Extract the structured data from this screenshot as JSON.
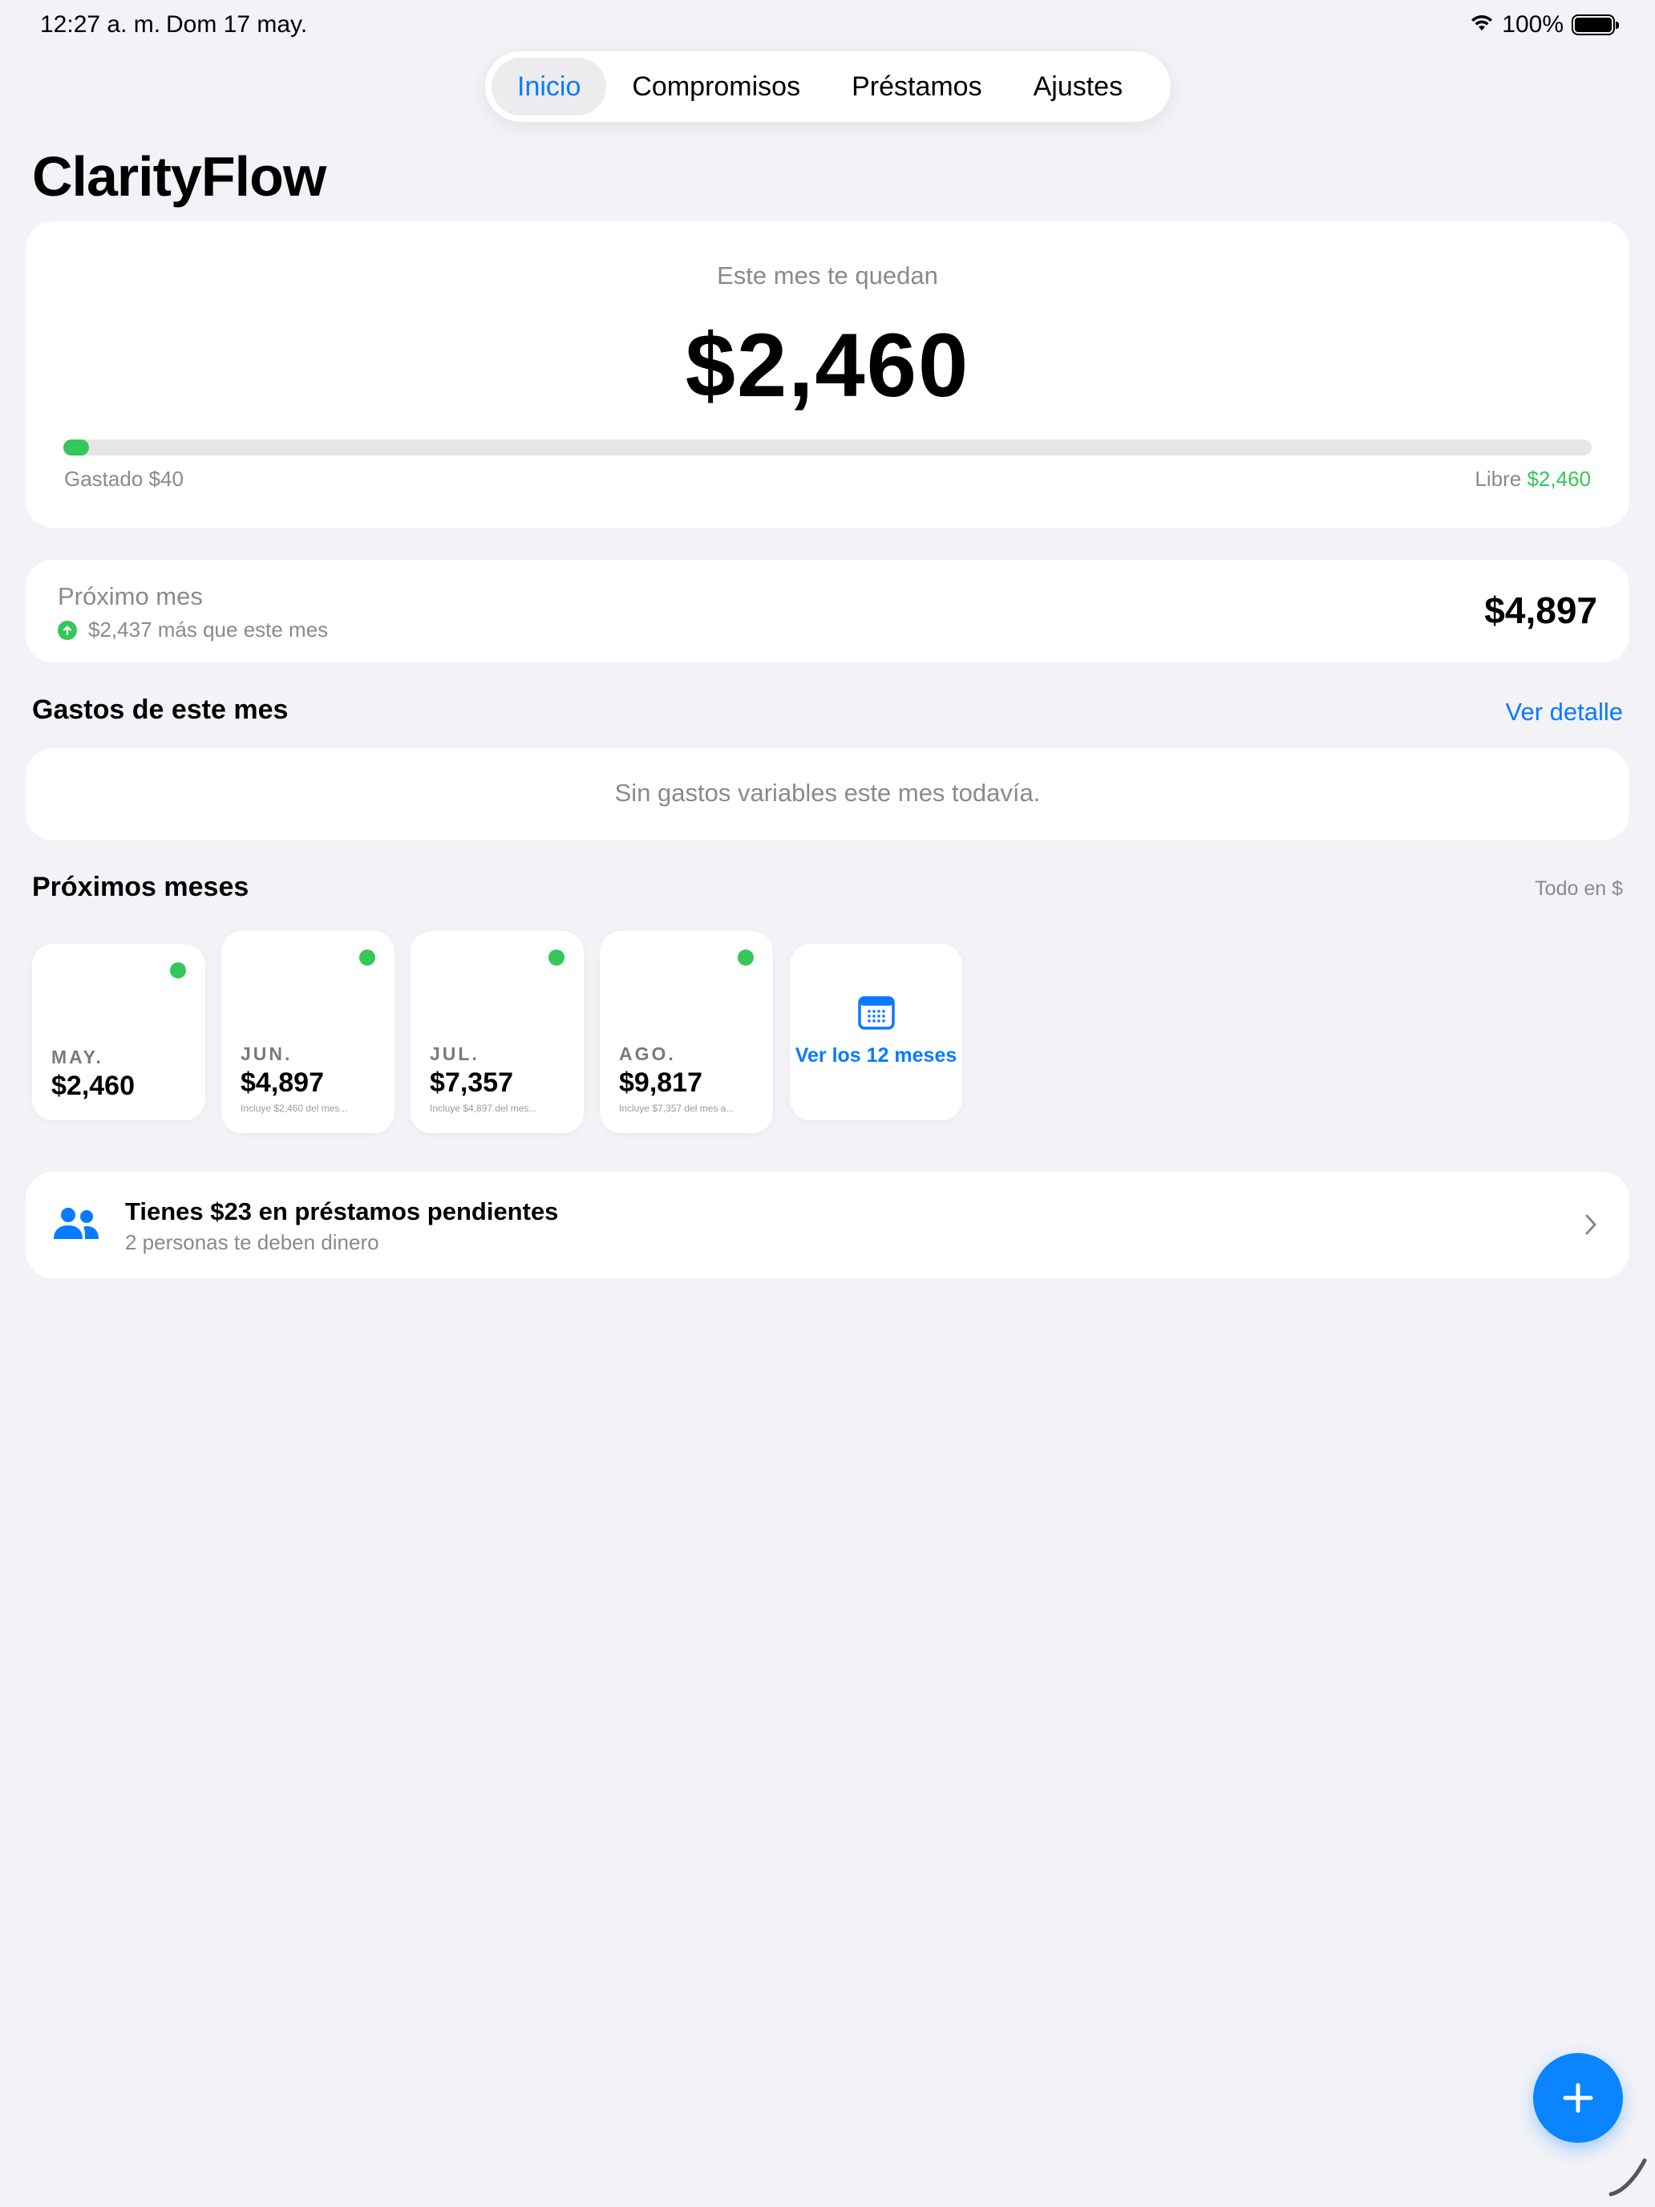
{
  "status_bar": {
    "time": "12:27 a. m.",
    "date": "Dom 17 may.",
    "battery": "100%"
  },
  "nav": {
    "tabs": [
      {
        "label": "Inicio",
        "active": true
      },
      {
        "label": "Compromisos",
        "active": false
      },
      {
        "label": "Préstamos",
        "active": false
      },
      {
        "label": "Ajustes",
        "active": false
      }
    ]
  },
  "app_title": "ClarityFlow",
  "balance": {
    "label": "Este mes te quedan",
    "amount": "$2,460",
    "spent_label": "Gastado",
    "spent_value": "$40",
    "free_label": "Libre",
    "free_value": "$2,460",
    "spent_fraction": 0.016
  },
  "next_month": {
    "title": "Próximo mes",
    "subtitle": "$2,437 más que este mes",
    "amount": "$4,897"
  },
  "expenses": {
    "title": "Gastos de este mes",
    "link": "Ver detalle",
    "empty": "Sin gastos variables este mes todavía."
  },
  "upcoming": {
    "title": "Próximos meses",
    "currency_note": "Todo en $",
    "months": [
      {
        "label": "MAY.",
        "amount": "$2,460",
        "note": ""
      },
      {
        "label": "JUN.",
        "amount": "$4,897",
        "note": "Incluye $2,460 del mes..."
      },
      {
        "label": "JUL.",
        "amount": "$7,357",
        "note": "Incluye $4,897 del mes..."
      },
      {
        "label": "AGO.",
        "amount": "$9,817",
        "note": "Incluye $7,357 del mes a..."
      }
    ],
    "all_label": "Ver los 12 meses"
  },
  "loans": {
    "title": "Tienes $23 en préstamos pendientes",
    "subtitle": "2 personas te deben dinero"
  },
  "colors": {
    "accent": "#0a7aff",
    "positive": "#34c759",
    "background": "#f2f2f7"
  }
}
